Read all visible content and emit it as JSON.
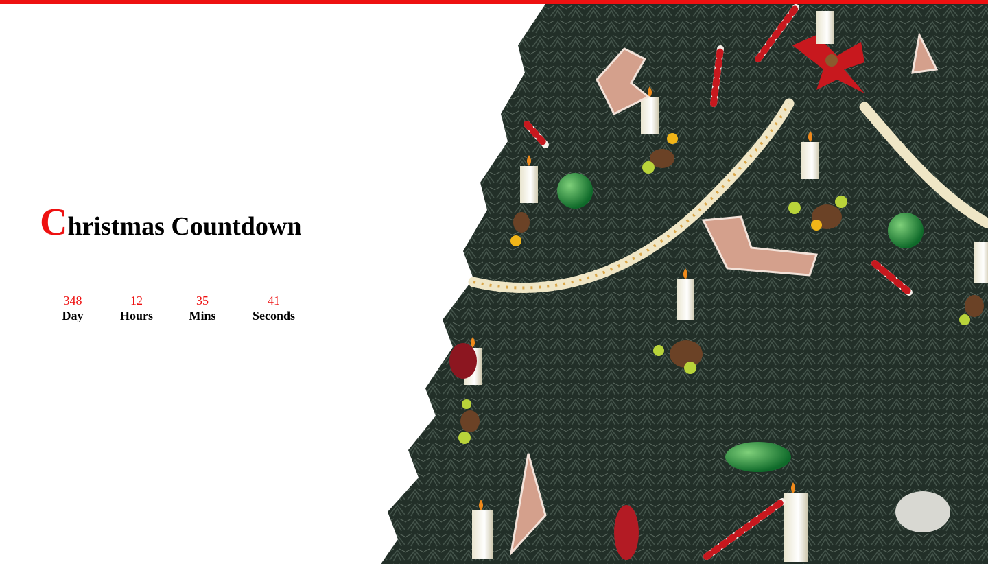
{
  "title": {
    "first_letter": "C",
    "rest": "hristmas Countdown"
  },
  "countdown": [
    {
      "value": "348",
      "label": "Day"
    },
    {
      "value": "12",
      "label": "Hours"
    },
    {
      "value": "35",
      "label": "Mins"
    },
    {
      "value": "41",
      "label": "Seconds"
    }
  ],
  "colors": {
    "accent": "#ee1111",
    "tree_dark": "#1f2b25",
    "tree_mid": "#3a4a3f",
    "tree_light": "#6d7d70"
  },
  "illustration": "christmas-tree-photo"
}
